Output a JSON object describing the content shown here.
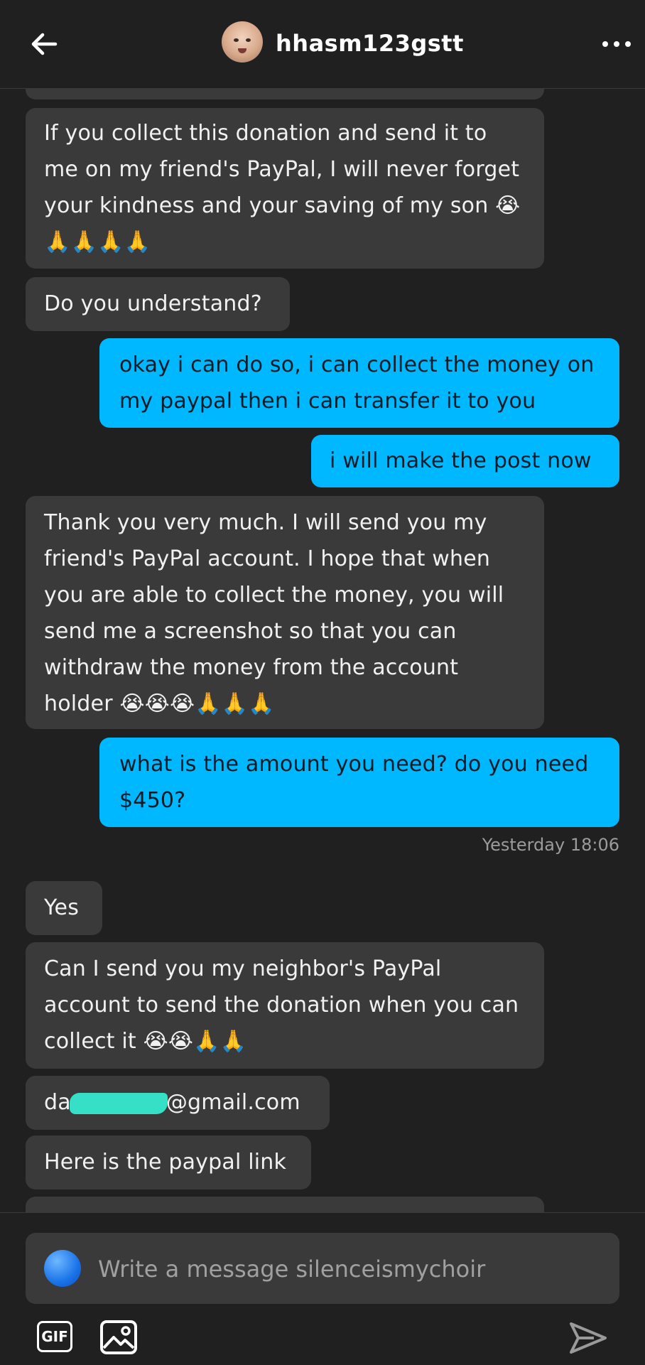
{
  "header": {
    "username": "hhasm123gstt"
  },
  "messages": [
    {
      "side": "in",
      "text": "If you collect this donation and send it to me on my friend's PayPal, I will never forget your kindness and your saving of my son 😭🙏🙏🙏🙏"
    },
    {
      "side": "in",
      "text": "Do you understand?"
    },
    {
      "side": "out",
      "text": "okay i can do so, i can collect the money on my paypal then i can transfer it to you"
    },
    {
      "side": "out",
      "text": "i will make the post now"
    },
    {
      "side": "in",
      "text": "Thank you very much. I will send you my friend's PayPal account. I hope that when you are able to collect the money, you will send me a screenshot so that you can withdraw the money from the account holder 😭😭😭🙏🙏🙏"
    },
    {
      "side": "out",
      "text": "what is the amount you need? do you need $450?"
    },
    {
      "side": "in",
      "text": "Yes"
    },
    {
      "side": "in",
      "text": "Can I send you my neighbor's PayPal account to send the donation when you can collect it 😭😭🙏🙏"
    },
    {
      "side": "in",
      "text_prefix": "da",
      "text_suffix": "@gmail.com"
    },
    {
      "side": "in",
      "text": "Here is the paypal link"
    }
  ],
  "timestamp": "Yesterday 18:06",
  "composer": {
    "placeholder": "Write a message silenceismychoir",
    "gif_label": "GIF"
  },
  "icons": [
    "back-arrow-icon",
    "more-dots-icon",
    "avatar",
    "gif-icon",
    "image-icon",
    "send-icon"
  ],
  "colors": {
    "background": "#202020",
    "incoming_bubble": "#3a3a3a",
    "outgoing_bubble": "#00b8ff",
    "redaction": "#35e0c6"
  }
}
